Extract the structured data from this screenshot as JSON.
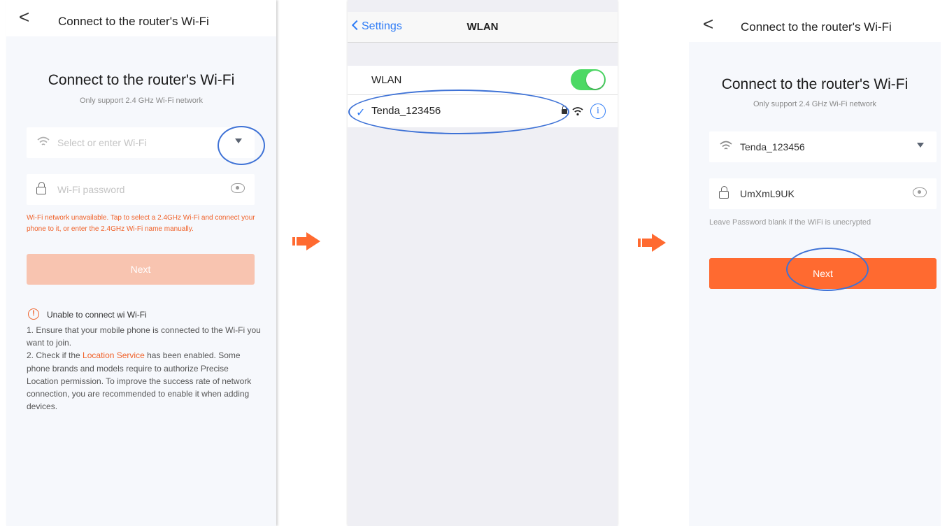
{
  "screen1": {
    "nav_back": "<",
    "nav_title": "Connect to the router's Wi-Fi",
    "heading": "Connect to the router's Wi-Fi",
    "subheading": "Only support 2.4 GHz Wi-Fi network",
    "wifi_placeholder": "Select or enter Wi-Fi",
    "password_placeholder": "Wi-Fi password",
    "error": "Wi-Fi network unavailable. Tap to select a 2.4GHz Wi-Fi and connect your phone to it, or enter the 2.4GHz Wi-Fi name manually.",
    "next_label": "Next",
    "tip_title": "Unable to connect wi Wi-Fi",
    "tip_icon": "!",
    "tip_1": "1. Ensure that your mobile phone is connected to the Wi-Fi you want to join.",
    "tip_2_pre": "2. Check if the ",
    "tip_2_link": "Location Service",
    "tip_2_post": " has been enabled. Some phone brands and models require to authorize Precise Location permission. To improve the success rate of network connection, you are recommended to enable it when adding devices."
  },
  "screen2": {
    "back_label": "Settings",
    "title": "WLAN",
    "wlan_label": "WLAN",
    "wlan_enabled": true,
    "check_mark": "✓",
    "network_name": "Tenda_123456",
    "info_icon": "i"
  },
  "screen3": {
    "nav_back": "<",
    "nav_title": "Connect to the router's Wi-Fi",
    "heading": "Connect to the router's Wi-Fi",
    "subheading": "Only support 2.4 GHz Wi-Fi network",
    "wifi_value": "Tenda_123456",
    "password_value": "UmXmL9UK",
    "hint": "Leave Password blank if the WiFi is unecrypted",
    "next_label": "Next"
  },
  "colors": {
    "accent": "#ff6a30",
    "disabled_button": "#f8c4b0",
    "highlight_circle": "#3e72d6",
    "ios_blue": "#2f7cf6",
    "ios_green": "#4cd964"
  },
  "icons": [
    "chevron-left-icon",
    "wifi-icon",
    "lock-icon",
    "eye-icon",
    "dropdown-arrow-icon",
    "warning-icon",
    "arrow-right-icon",
    "checkmark-icon",
    "info-icon"
  ]
}
